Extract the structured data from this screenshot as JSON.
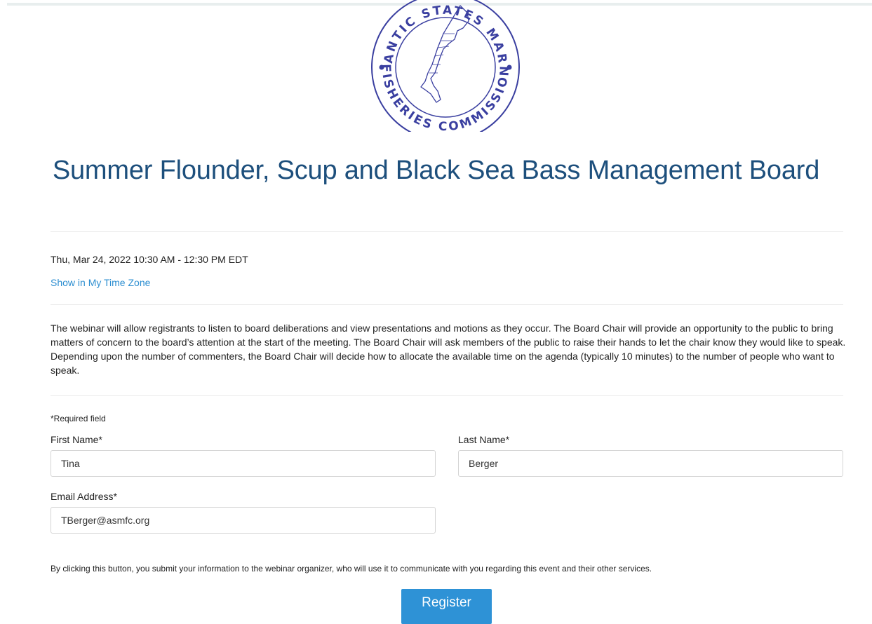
{
  "logo": {
    "ring_text_top": "ATLANTIC STATES MARINE",
    "ring_text_bottom": "FISHERIES COMMISSION",
    "color": "#3a3fa0"
  },
  "event": {
    "title": "Summer Flounder, Scup and Black Sea Bass Management Board",
    "datetime": "Thu, Mar 24, 2022 10:30 AM - 12:30 PM EDT",
    "timezone_link": "Show in My Time Zone",
    "description": "The webinar will allow registrants to listen to board deliberations and view presentations and motions as they occur.  The Board Chair will provide an opportunity to the public to bring matters of concern to the board’s attention at the start of the meeting. The Board Chair will ask members of the public to raise their hands to let the chair know they would like to speak. Depending upon the number of commenters, the Board Chair will decide how to allocate the available time on the agenda (typically 10 minutes) to the number of people who want to speak."
  },
  "form": {
    "required_note": "*Required field",
    "first_name": {
      "label": "First Name*",
      "value": "Tina"
    },
    "last_name": {
      "label": "Last Name*",
      "value": "Berger"
    },
    "email": {
      "label": "Email Address*",
      "value": "TBerger@asmfc.org"
    },
    "consent": "By clicking this button, you submit your information to the webinar organizer, who will use it to communicate with you regarding this event and their other services.",
    "register_label": "Register"
  },
  "colors": {
    "title": "#1d4f7c",
    "link": "#2e8fd1",
    "button": "#2e92d6"
  }
}
